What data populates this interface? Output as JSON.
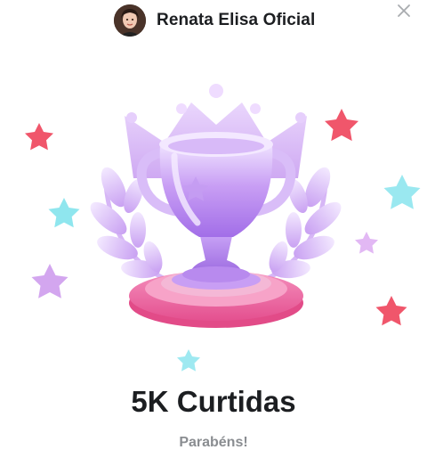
{
  "header": {
    "avatar_icon": "profile-photo",
    "username": "Renata Elisa Oficial",
    "close_icon": "close-icon"
  },
  "milestone": {
    "illustration": "trophy-with-laurels-and-stars",
    "title": "5K Curtidas",
    "subtitle": "Parabéns!"
  },
  "colors": {
    "trophy_purple": "#c79cf2",
    "trophy_pink": "#ec5f9f",
    "star_red": "#f0566b",
    "star_cyan": "#8fe6ee",
    "star_lilac": "#d3a6ef",
    "text_dark": "#1c1e21",
    "text_muted": "#8a8d91"
  }
}
